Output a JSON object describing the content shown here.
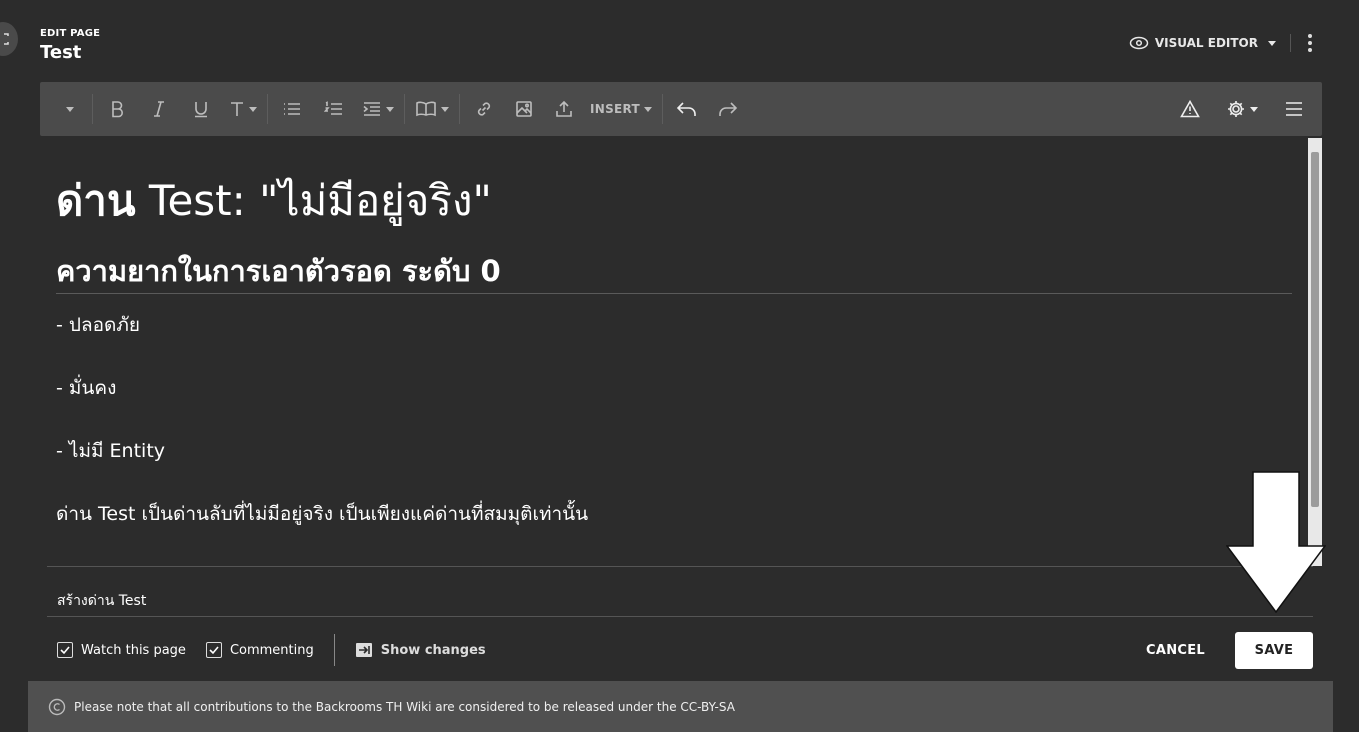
{
  "header": {
    "edit_label": "EDIT PAGE",
    "page_title": "Test",
    "visual_editor_label": "VISUAL EDITOR"
  },
  "toolbar": {
    "insert_label": "INSERT"
  },
  "content": {
    "h1_bold": "ด่าน",
    "h1_rest": " Test: \"ไม่มีอยู่จริง\"",
    "h2": "ความยากในการเอาตัวรอด ระดับ 0",
    "bullet1": "- ปลอดภัย",
    "bullet2": "- มั่นคง",
    "bullet3": "- ไม่มี Entity",
    "description": "ด่าน Test เป็นด่านลับที่ไม่มีอยู่จริง เป็นเพียงแค่ด่านที่สมมุติเท่านั้น"
  },
  "summary": {
    "value": "สร้างด่าน Test"
  },
  "options": {
    "watch_label": "Watch this page",
    "watch_checked": true,
    "commenting_label": "Commenting",
    "commenting_checked": true,
    "show_changes_label": "Show changes"
  },
  "actions": {
    "cancel_label": "CANCEL",
    "save_label": "SAVE"
  },
  "license": {
    "text": "Please note that all contributions to the Backrooms TH Wiki are considered to be released under the CC-BY-SA"
  },
  "colors": {
    "background": "#2c2c2c",
    "toolbar": "#4b4b4b",
    "license_bar": "#505050",
    "save_button": "#ffffff"
  }
}
